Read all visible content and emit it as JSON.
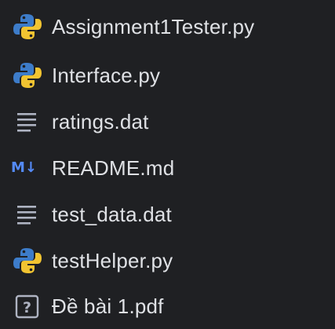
{
  "files": [
    {
      "name": "Assignment1Tester.py",
      "icon": "python-icon"
    },
    {
      "name": "Interface.py",
      "icon": "python-icon"
    },
    {
      "name": "ratings.dat",
      "icon": "text-file-icon"
    },
    {
      "name": "README.md",
      "icon": "markdown-icon",
      "icon_text": "M↓"
    },
    {
      "name": "test_data.dat",
      "icon": "text-file-icon"
    },
    {
      "name": "testHelper.py",
      "icon": "python-icon"
    },
    {
      "name": "Đề bài 1.pdf",
      "icon": "unknown-file-icon",
      "icon_text": "?"
    }
  ],
  "colors": {
    "background": "#1f2023",
    "text": "#dfe1e5",
    "python_blue": "#3d7cc9",
    "python_yellow": "#f2c431",
    "markdown_blue": "#548af7",
    "icon_gray": "#aeb3c2"
  }
}
